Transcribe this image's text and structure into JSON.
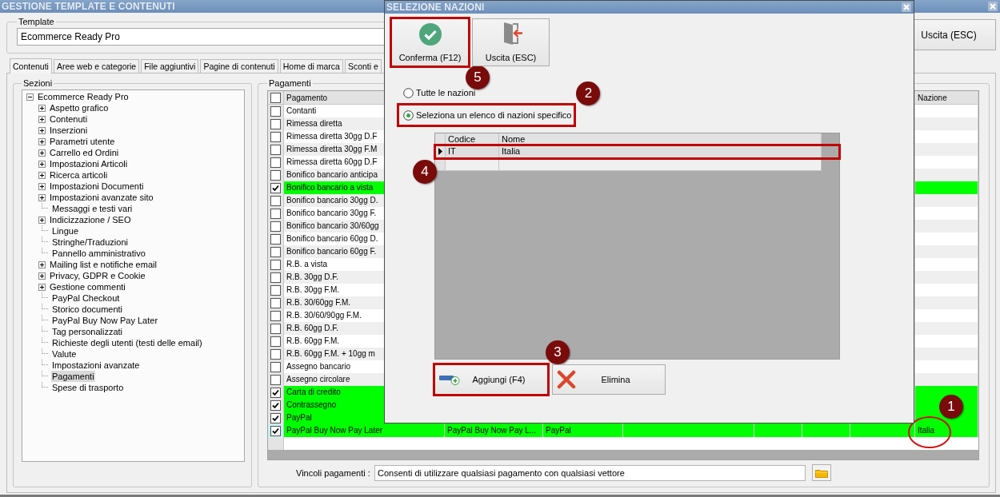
{
  "window": {
    "title": "GESTIONE TEMPLATE E CONTENUTI"
  },
  "template": {
    "label": "Template",
    "value": "Ecommerce Ready Pro"
  },
  "exit_button": {
    "label": "Uscita (ESC)"
  },
  "tabs": [
    {
      "label": "Contenuti",
      "selected": true
    },
    {
      "label": "Aree web e categorie",
      "selected": false
    },
    {
      "label": "File aggiuntivi",
      "selected": false
    },
    {
      "label": "Pagine di contenuti",
      "selected": false
    },
    {
      "label": "Home di marca",
      "selected": false
    },
    {
      "label": "Sconti e",
      "selected": false
    }
  ],
  "sections": {
    "title": "Sezioni",
    "tree": [
      {
        "label": "Ecommerce Ready Pro",
        "kind": "folder",
        "expanded": true,
        "selected": false,
        "children": [
          {
            "label": "Aspetto grafico",
            "kind": "folder",
            "expanded": false,
            "selected": false
          },
          {
            "label": "Contenuti",
            "kind": "folder",
            "expanded": false,
            "selected": false
          },
          {
            "label": "Inserzioni",
            "kind": "folder",
            "expanded": false,
            "selected": false
          },
          {
            "label": "Parametri utente",
            "kind": "folder",
            "expanded": false,
            "selected": false
          },
          {
            "label": "Carrello ed Ordini",
            "kind": "folder",
            "expanded": false,
            "selected": false
          },
          {
            "label": "Impostazioni Articoli",
            "kind": "folder",
            "expanded": false,
            "selected": false
          },
          {
            "label": "Ricerca articoli",
            "kind": "folder",
            "expanded": false,
            "selected": false
          },
          {
            "label": "Impostazioni Documenti",
            "kind": "folder",
            "expanded": false,
            "selected": false
          },
          {
            "label": "Impostazioni avanzate sito",
            "kind": "folder",
            "expanded": false,
            "selected": false
          },
          {
            "label": "Messaggi e testi vari",
            "kind": "leaf",
            "selected": false
          },
          {
            "label": "Indicizzazione / SEO",
            "kind": "folder",
            "expanded": false,
            "selected": false
          },
          {
            "label": "Lingue",
            "kind": "leaf",
            "selected": false
          },
          {
            "label": "Stringhe/Traduzioni",
            "kind": "leaf",
            "selected": false
          },
          {
            "label": "Pannello amministrativo",
            "kind": "leaf",
            "selected": false
          },
          {
            "label": "Mailing list e notifiche email",
            "kind": "folder",
            "expanded": false,
            "selected": false
          },
          {
            "label": "Privacy, GDPR e Cookie",
            "kind": "folder",
            "expanded": false,
            "selected": false
          },
          {
            "label": "Gestione commenti",
            "kind": "folder",
            "expanded": false,
            "selected": false
          },
          {
            "label": "PayPal Checkout",
            "kind": "leaf",
            "selected": false
          },
          {
            "label": "Storico documenti",
            "kind": "leaf",
            "selected": false
          },
          {
            "label": "PayPal Buy Now Pay Later",
            "kind": "leaf",
            "selected": false
          },
          {
            "label": "Tag personalizzati",
            "kind": "leaf",
            "selected": false
          },
          {
            "label": "Richieste degli utenti (testi delle email)",
            "kind": "leaf",
            "selected": false
          },
          {
            "label": "Valute",
            "kind": "leaf",
            "selected": false
          },
          {
            "label": "Impostazioni avanzate",
            "kind": "leaf",
            "selected": false
          },
          {
            "label": "Pagamenti",
            "kind": "leaf",
            "selected": true
          },
          {
            "label": "Spese di trasporto",
            "kind": "leaf",
            "selected": false
          }
        ]
      }
    ]
  },
  "payments": {
    "title": "Pagamenti",
    "header_checked": false,
    "columns": [
      "Pagamento",
      "Nazione"
    ],
    "rows": [
      {
        "name": "Contanti",
        "checked": false
      },
      {
        "name": "Rimessa diretta",
        "checked": false
      },
      {
        "name": "Rimessa diretta 30gg D.F",
        "checked": false
      },
      {
        "name": "Rimessa diretta 30gg F.M",
        "checked": false
      },
      {
        "name": "Rimessa diretta 60gg D.F",
        "checked": false
      },
      {
        "name": "Bonifico bancario anticipa",
        "checked": false
      },
      {
        "name": "Bonifico bancario a vista",
        "checked": true
      },
      {
        "name": "Bonifico bancario 30gg D.",
        "checked": false
      },
      {
        "name": "Bonifico bancario 30gg F.",
        "checked": false
      },
      {
        "name": "Bonifico bancario 30/60gg",
        "checked": false
      },
      {
        "name": "Bonifico bancario 60gg D.",
        "checked": false
      },
      {
        "name": "Bonifico bancario 60gg F.",
        "checked": false
      },
      {
        "name": "R.B. a vista",
        "checked": false
      },
      {
        "name": "R.B. 30gg D.F.",
        "checked": false
      },
      {
        "name": "R.B. 30gg F.M.",
        "checked": false
      },
      {
        "name": "R.B. 30/60gg F.M.",
        "checked": false
      },
      {
        "name": "R.B. 30/60/90gg F.M.",
        "checked": false
      },
      {
        "name": "R.B. 60gg D.F.",
        "checked": false
      },
      {
        "name": "R.B. 60gg F.M.",
        "checked": false
      },
      {
        "name": "R.B. 60gg F.M. + 10gg m",
        "checked": false
      },
      {
        "name": "Assegno bancario",
        "checked": false
      },
      {
        "name": "Assegno circolare",
        "checked": false
      },
      {
        "name": "Carta di credito",
        "checked": true
      },
      {
        "name": "Contrassegno",
        "checked": true
      },
      {
        "name": "PayPal",
        "checked": true
      },
      {
        "name": "PayPal Buy Now Pay Later",
        "checked": true,
        "current": true,
        "column_2": "PayPal Buy Now Pay L...",
        "column_3": "PayPal",
        "nation": "Italia",
        "nation_circled": true,
        "badge": "1"
      }
    ],
    "constraints_label": "Vincoli pagamenti :",
    "constraints_value": "Consenti di utilizzare qualsiasi pagamento con qualsiasi vettore"
  },
  "dialog": {
    "title": "SELEZIONE NAZIONI",
    "buttons": [
      {
        "label": "Conferma (F12)",
        "kind": "confirm",
        "highlighted": true,
        "badge": "5"
      },
      {
        "label": "Uscita (ESC)",
        "kind": "exit",
        "highlighted": false
      }
    ],
    "options": [
      {
        "label": "Tutte le nazioni",
        "selected": false,
        "highlighted": false
      },
      {
        "label": "Seleziona un elenco di nazioni specifico",
        "selected": true,
        "highlighted": true,
        "badge": "2"
      }
    ],
    "nations": {
      "columns": [
        "Codice",
        "Nome"
      ],
      "rows": [
        {
          "code": "IT",
          "name": "Italia",
          "current": true,
          "highlighted": true,
          "badge": "4"
        }
      ]
    },
    "actions": [
      {
        "label": "Aggiungi (F4)",
        "kind": "add",
        "highlighted": true,
        "badge": "3"
      },
      {
        "label": "Elimina",
        "kind": "delete",
        "highlighted": false
      }
    ]
  }
}
